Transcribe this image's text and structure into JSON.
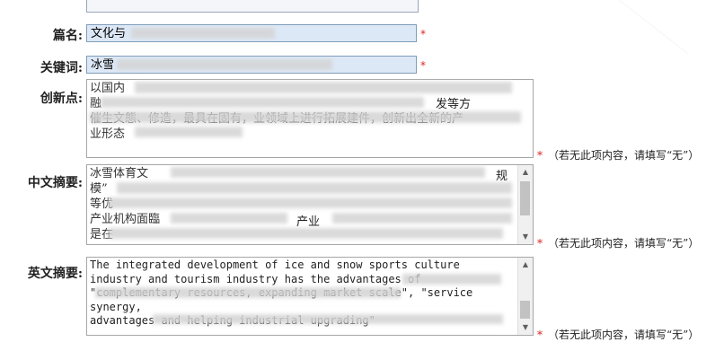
{
  "form": {
    "title": {
      "label": "篇名:",
      "value": "文化与"
    },
    "keywords": {
      "label": "关键词:",
      "value": "冰雪"
    },
    "innovation": {
      "label": "创新点:",
      "lines": [
        "以国内",
        "融",
        "面",
        "业形态"
      ],
      "fragment_right_1": "发等方",
      "fragment_right_2": "催生文態、修造，最具在固有，业领域上进行拓展建件，创新出全新的产"
    },
    "abstract_cn": {
      "label": "中文摘要:",
      "lines": [
        "冰雪体育文",
        "模”",
        "等优",
        "产业机构面臨",
        "是在"
      ],
      "fragment_right_1": "规",
      "fragment_right_2": "产业"
    },
    "abstract_en": {
      "label": "英文摘要:",
      "lines": [
        "The integrated development of ice and snow sports culture",
        "industry and tourism industry has the advantages of",
        "\"complementary resources, expanding market scale\", \"service",
        "synergy,",
        "advantages and helping industrial upgrading\""
      ]
    },
    "required_mark": "*",
    "note_text": "（若无此项内容，请填写“无”）"
  }
}
